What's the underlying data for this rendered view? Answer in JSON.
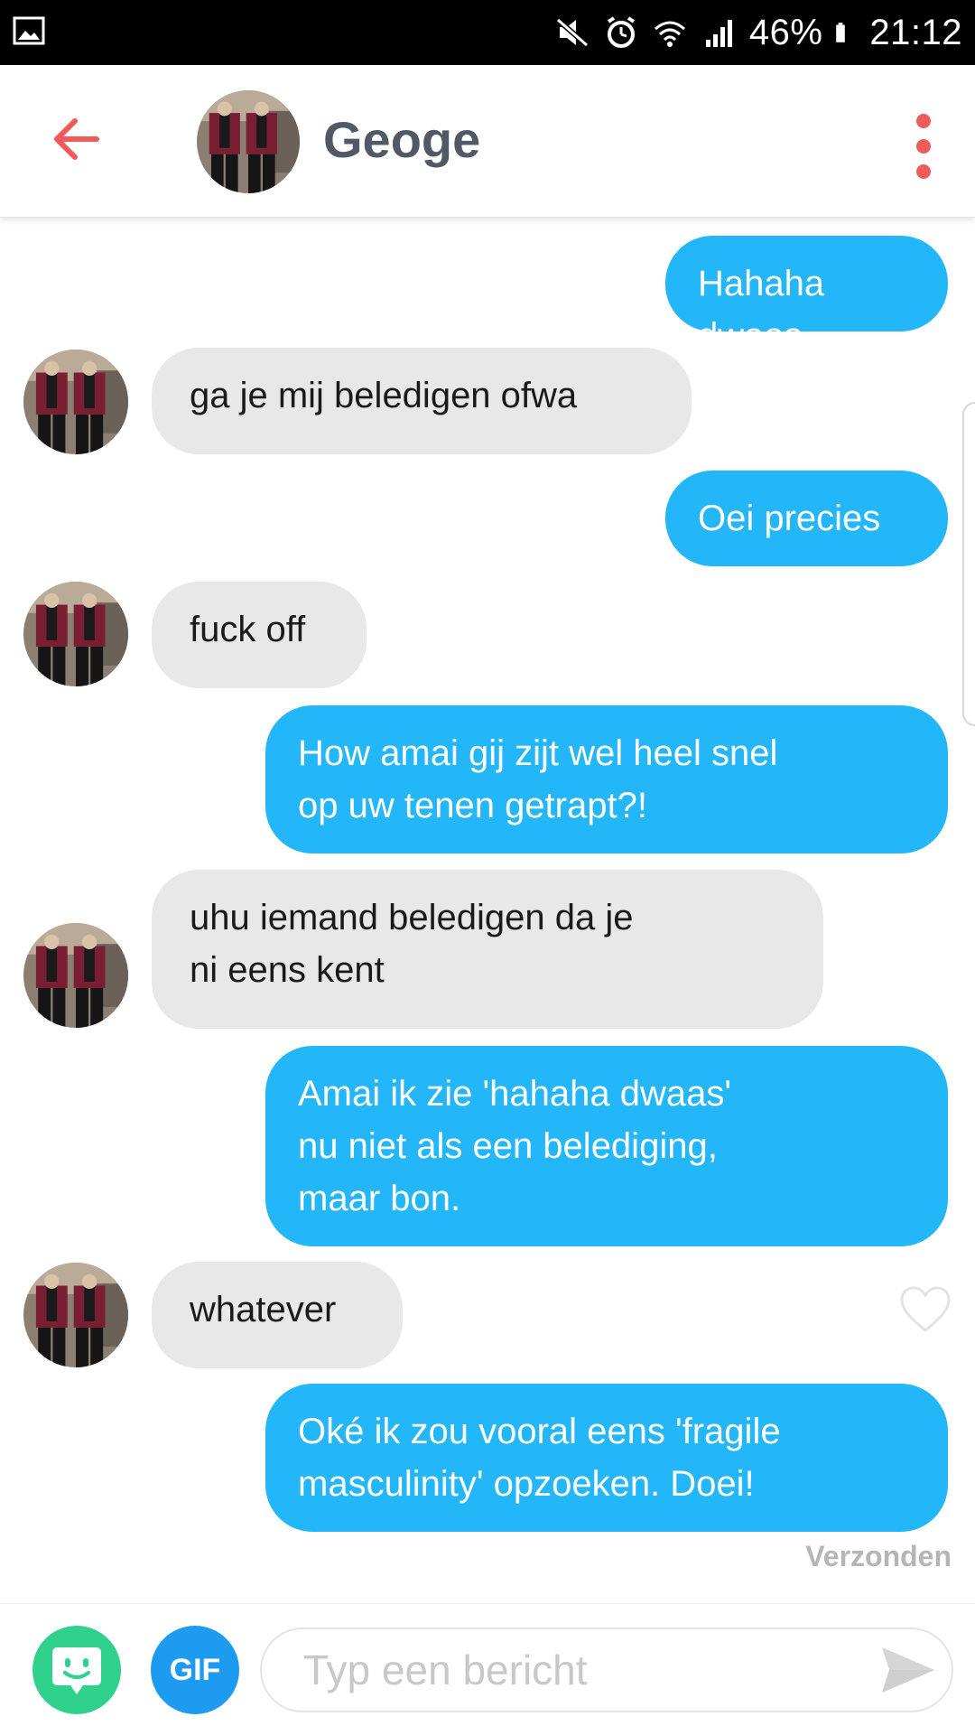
{
  "status_bar": {
    "battery": "46%",
    "time": "21:12"
  },
  "header": {
    "name": "Geoge"
  },
  "messages": [
    {
      "from": "me",
      "text": "Hahaha dwaas"
    },
    {
      "from": "them",
      "text": "ga je mij beledigen ofwa"
    },
    {
      "from": "me",
      "text": "Oei precies"
    },
    {
      "from": "them",
      "text": "fuck off"
    },
    {
      "from": "me",
      "text": "How amai gij zijt wel heel snel\nop uw tenen getrapt?!"
    },
    {
      "from": "them",
      "text": "uhu iemand beledigen da je\nni eens kent"
    },
    {
      "from": "me",
      "text": "Amai ik zie 'hahaha dwaas'\nnu niet als een belediging,\nmaar bon."
    },
    {
      "from": "them",
      "text": "whatever"
    },
    {
      "from": "me",
      "text": "Oké ik zou vooral eens 'fragile\nmasculinity' opzoeken. Doei!"
    }
  ],
  "sent_status": "Verzonden",
  "footer": {
    "gif_label": "GIF",
    "placeholder": "Typ een bericht"
  },
  "colors": {
    "outgoing": "#23b7fa",
    "incoming": "#e8e8e8",
    "accent": "#ef5b5b"
  }
}
